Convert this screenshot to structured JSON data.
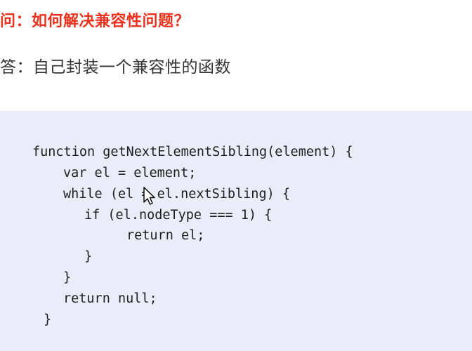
{
  "question": "问：如何解决兼容性问题？",
  "answer": "答：自己封装一个兼容性的函数",
  "code": {
    "lines": [
      "function getNextElementSibling(element) {",
      "var el = element;",
      "while (el = el.nextSibling) {",
      "if (el.nodeType === 1) {",
      "return el;",
      "}",
      "}",
      "return null;",
      "}"
    ]
  },
  "colors": {
    "question": "#e8321e",
    "answer": "#333333",
    "code_background": "#e9edf8",
    "code_text": "#1f1f1f"
  },
  "icons": {
    "cursor": "mouse-pointer-icon"
  }
}
